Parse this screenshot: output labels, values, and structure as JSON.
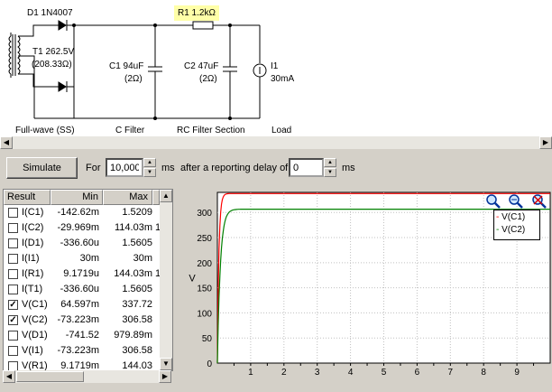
{
  "schematic": {
    "diode": "D1 1N4007",
    "transformer": "T1 262.5V",
    "transformer_r": "(208.33Ω)",
    "r1": "R1 1.2kΩ",
    "c1": "C1 94uF",
    "c1_r": "(2Ω)",
    "c2": "C2 47uF",
    "c2_r": "(2Ω)",
    "i1": "I1",
    "i1_val": "30mA",
    "section_labels": [
      "Full-wave (SS)",
      "C Filter",
      "RC Filter Section",
      "Load"
    ]
  },
  "toolbar": {
    "simulate_label": "Simulate",
    "for_label": "For",
    "duration_value": "10,000",
    "ms_label": "ms",
    "delay_label": "after a reporting delay of",
    "delay_value": "0",
    "ms_label2": "ms"
  },
  "results": {
    "headers": [
      "Result",
      "Min",
      "Max"
    ],
    "rows": [
      {
        "name": "I(C1)",
        "min": "-142.62m",
        "max": "1.5209",
        "checked": false,
        "extra": ""
      },
      {
        "name": "I(C2)",
        "min": "-29.969m",
        "max": "114.03m",
        "checked": false,
        "extra": "1"
      },
      {
        "name": "I(D1)",
        "min": "-336.60u",
        "max": "1.5605",
        "checked": false,
        "extra": ""
      },
      {
        "name": "I(I1)",
        "min": "30m",
        "max": "30m",
        "checked": false,
        "extra": ""
      },
      {
        "name": "I(R1)",
        "min": "9.1719u",
        "max": "144.03m",
        "checked": false,
        "extra": "1"
      },
      {
        "name": "I(T1)",
        "min": "-336.60u",
        "max": "1.5605",
        "checked": false,
        "extra": ""
      },
      {
        "name": "V(C1)",
        "min": "64.597m",
        "max": "337.72",
        "checked": true,
        "extra": ""
      },
      {
        "name": "V(C2)",
        "min": "-73.223m",
        "max": "306.58",
        "checked": true,
        "extra": ""
      },
      {
        "name": "V(D1)",
        "min": "-741.52",
        "max": "979.89m",
        "checked": false,
        "extra": ""
      },
      {
        "name": "V(I1)",
        "min": "-73.223m",
        "max": "306.58",
        "checked": false,
        "extra": ""
      },
      {
        "name": "V(R1)",
        "min": "9.1719m",
        "max": "144.03",
        "checked": false,
        "extra": ""
      }
    ]
  },
  "chart_data": {
    "type": "line",
    "ylabel": "V",
    "xlabel": "",
    "xlim": [
      0,
      10
    ],
    "ylim": [
      0,
      340
    ],
    "xticks": [
      "1",
      "2",
      "3",
      "4",
      "5",
      "6",
      "7",
      "8",
      "9"
    ],
    "yticks": [
      "0",
      "50",
      "100",
      "150",
      "200",
      "250",
      "300"
    ],
    "grid": true,
    "legend_position": "top-right",
    "series": [
      {
        "name": "V(C1)",
        "color": "#ff0000",
        "final": 337.72,
        "tau": 0.045
      },
      {
        "name": "V(C2)",
        "color": "#008000",
        "final": 306.58,
        "tau": 0.09
      }
    ]
  },
  "zoom_icons": [
    "zoom-in-icon",
    "zoom-out-icon",
    "zoom-reset-icon"
  ]
}
